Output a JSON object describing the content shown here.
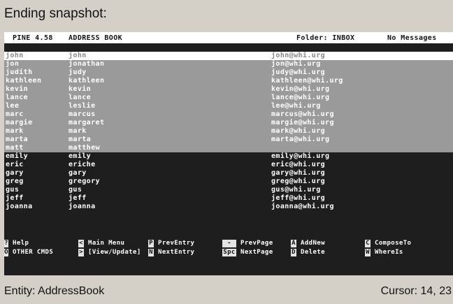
{
  "caption": "Ending snapshot:",
  "titlebar": {
    "app": "PINE 4.58",
    "screen": "ADDRESS BOOK",
    "folder": "Folder: INBOX",
    "messages": "No Messages"
  },
  "entries": [
    {
      "nick": "john",
      "full": "john",
      "email": "john@whi.urg",
      "state": "selected"
    },
    {
      "nick": "jon",
      "full": "jonathan",
      "email": "jon@whi.urg",
      "state": "highlight"
    },
    {
      "nick": "judith",
      "full": "judy",
      "email": "judy@whi.urg",
      "state": "highlight"
    },
    {
      "nick": "kathleen",
      "full": "kathleen",
      "email": "kathleen@whi.urg",
      "state": "highlight"
    },
    {
      "nick": "kevin",
      "full": "kevin",
      "email": "kevin@whi.urg",
      "state": "highlight"
    },
    {
      "nick": "lance",
      "full": "lance",
      "email": "lance@whi.urg",
      "state": "highlight"
    },
    {
      "nick": "lee",
      "full": "leslie",
      "email": "lee@whi.urg",
      "state": "highlight"
    },
    {
      "nick": "marc",
      "full": "marcus",
      "email": "marcus@whi.urg",
      "state": "highlight"
    },
    {
      "nick": "margie",
      "full": "margaret",
      "email": "margie@whi.urg",
      "state": "highlight"
    },
    {
      "nick": "mark",
      "full": "mark",
      "email": "mark@whi.urg",
      "state": "highlight"
    },
    {
      "nick": "marta",
      "full": "marta",
      "email": "marta@whi.urg",
      "state": "highlight"
    },
    {
      "nick": "matt",
      "full": "matthew",
      "email": "",
      "state": "highlight"
    },
    {
      "nick": "emily",
      "full": "emily",
      "email": "emily@whi.urg",
      "state": "normal"
    },
    {
      "nick": "eric",
      "full": "eriche",
      "email": "eric@whi.urg",
      "state": "normal"
    },
    {
      "nick": "gary",
      "full": "gary",
      "email": "gary@whi.urg",
      "state": "normal"
    },
    {
      "nick": "greg",
      "full": "gregory",
      "email": "greg@whi.urg",
      "state": "normal"
    },
    {
      "nick": "gus",
      "full": "gus",
      "email": "gus@whi.urg",
      "state": "normal"
    },
    {
      "nick": "jeff",
      "full": "jeff",
      "email": "jeff@whi.urg",
      "state": "normal"
    },
    {
      "nick": "joanna",
      "full": "joanna",
      "email": "joanna@whi.urg",
      "state": "normal"
    }
  ],
  "menu": [
    {
      "key": "?",
      "label": "Help"
    },
    {
      "key": "O",
      "label": "OTHER CMDS"
    },
    {
      "key": "<",
      "label": "Main Menu"
    },
    {
      "key": ">",
      "label": "[View/Update]"
    },
    {
      "key": "P",
      "label": "PrevEntry"
    },
    {
      "key": "N",
      "label": "NextEntry"
    },
    {
      "key": "-",
      "label": "PrevPage"
    },
    {
      "key": "Spc",
      "label": "NextPage"
    },
    {
      "key": "A",
      "label": "AddNew"
    },
    {
      "key": "D",
      "label": "Delete"
    },
    {
      "key": "C",
      "label": "ComposeTo"
    },
    {
      "key": "W",
      "label": "WhereIs"
    }
  ],
  "status": {
    "entity": "Entity: AddressBook",
    "cursor": "Cursor: 14, 23"
  },
  "colors": {
    "terminal_bg": "#1e1e1e",
    "highlight_bg": "#9a9a9a",
    "selected_bg": "#ffffff",
    "window_bg": "#d4d0c8"
  }
}
